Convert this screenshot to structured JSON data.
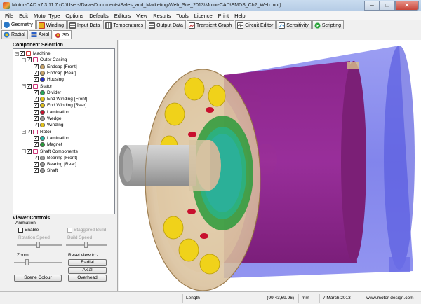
{
  "window": {
    "title": "Motor-CAD v7.3.11.7 (C:\\Users\\Dave\\Documents\\Sales_and_Marketing\\Web_Site_2013\\Motor-CAD\\EMDS_Ch2_Web.mot)",
    "minimize": "─",
    "maximize": "□",
    "close": "✕"
  },
  "menu": [
    "File",
    "Edit",
    "Motor Type",
    "Options",
    "Defaults",
    "Editors",
    "View",
    "Results",
    "Tools",
    "Licence",
    "Print",
    "Help"
  ],
  "tabs": [
    {
      "label": "Geometry",
      "icon": "geometry-icon",
      "color": "#2a78c8"
    },
    {
      "label": "Winding",
      "icon": "winding-icon",
      "color": "#e7b21a"
    },
    {
      "label": "Input Data",
      "icon": "input-data-icon",
      "color": "#6f6f6f"
    },
    {
      "label": "Temperatures",
      "icon": "temperatures-icon",
      "color": "#7f7f7f"
    },
    {
      "label": "Output Data",
      "icon": "output-data-icon",
      "color": "#6f6f6f"
    },
    {
      "label": "Transient Graph",
      "icon": "transient-graph-icon",
      "color": "#c63a3a"
    },
    {
      "label": "Circuit Editor",
      "icon": "circuit-editor-icon",
      "color": "#444444"
    },
    {
      "label": "Sensitivity",
      "icon": "sensitivity-icon",
      "color": "#3a8fd1"
    },
    {
      "label": "Scripting",
      "icon": "scripting-icon",
      "color": "#2aa33a"
    }
  ],
  "subtabs": [
    {
      "label": "Radial",
      "icon": "radial-icon"
    },
    {
      "label": "Axial",
      "icon": "axial-icon"
    },
    {
      "label": "3D",
      "icon": "3d-icon"
    }
  ],
  "component_selection": {
    "title": "Component Selection",
    "tree": [
      {
        "label": "Machine",
        "level": 0,
        "expander": "−",
        "icon": "machine-icon",
        "color": "#cc3333"
      },
      {
        "label": "Outer Casing",
        "level": 1,
        "expander": "−",
        "icon": "outer-casing-icon",
        "color": "#cc3377"
      },
      {
        "label": "Endcap [Front]",
        "level": 2,
        "icon": "endcap-front-icon",
        "color": "#c8a46a"
      },
      {
        "label": "Endcap [Rear]",
        "level": 2,
        "icon": "endcap-rear-icon",
        "color": "#c8a46a"
      },
      {
        "label": "Housing",
        "level": 2,
        "icon": "housing-icon",
        "color": "#2430c8"
      },
      {
        "label": "Stator",
        "level": 1,
        "expander": "−",
        "icon": "stator-icon",
        "color": "#cc3377"
      },
      {
        "label": "Divider",
        "level": 2,
        "icon": "divider-icon",
        "color": "#2aa55a"
      },
      {
        "label": "End Winding [Front]",
        "level": 2,
        "icon": "end-winding-front-icon",
        "color": "#e3c21a"
      },
      {
        "label": "End Winding [Rear]",
        "level": 2,
        "icon": "end-winding-rear-icon",
        "color": "#e3c21a"
      },
      {
        "label": "Lamination",
        "level": 2,
        "icon": "stator-lamination-icon",
        "color": "#c8102e"
      },
      {
        "label": "Wedge",
        "level": 2,
        "icon": "wedge-icon",
        "color": "#9a9a9a"
      },
      {
        "label": "Winding",
        "level": 2,
        "icon": "winding-node-icon",
        "color": "#e3c21a"
      },
      {
        "label": "Rotor",
        "level": 1,
        "expander": "−",
        "icon": "rotor-icon",
        "color": "#cc3377"
      },
      {
        "label": "Lamination",
        "level": 2,
        "icon": "rotor-lamination-icon",
        "color": "#28b8a8"
      },
      {
        "label": "Magnet",
        "level": 2,
        "icon": "magnet-icon",
        "color": "#2a9a3a"
      },
      {
        "label": "Shaft Components",
        "level": 1,
        "expander": "−",
        "icon": "shaft-components-icon",
        "color": "#cc3377"
      },
      {
        "label": "Bearing [Front]",
        "level": 2,
        "icon": "bearing-front-icon",
        "color": "#9a9a9a"
      },
      {
        "label": "Bearing [Rear]",
        "level": 2,
        "icon": "bearing-rear-icon",
        "color": "#9a9a9a"
      },
      {
        "label": "Shaft",
        "level": 2,
        "icon": "shaft-icon",
        "color": "#9a9a9a"
      }
    ]
  },
  "viewer_controls": {
    "title": "Viewer Controls",
    "animation_label": "Animation",
    "enable_label": "Enable",
    "staggered_build_label": "Staggered Build",
    "rotation_speed_label": "Rotation Speed",
    "build_speed_label": "Build Speed",
    "zoom_label": "Zoom",
    "reset_view_label": "Reset view to:-",
    "radial_button": "Radial",
    "axial_button": "Axial",
    "overhead_button": "Overhead",
    "scene_colour_button": "Scene Colour"
  },
  "status": {
    "field_label": "Length",
    "coords": "(99.43,69.96)",
    "unit": "mm",
    "date": "7 March 2013",
    "website": "www.motor-design.com"
  }
}
